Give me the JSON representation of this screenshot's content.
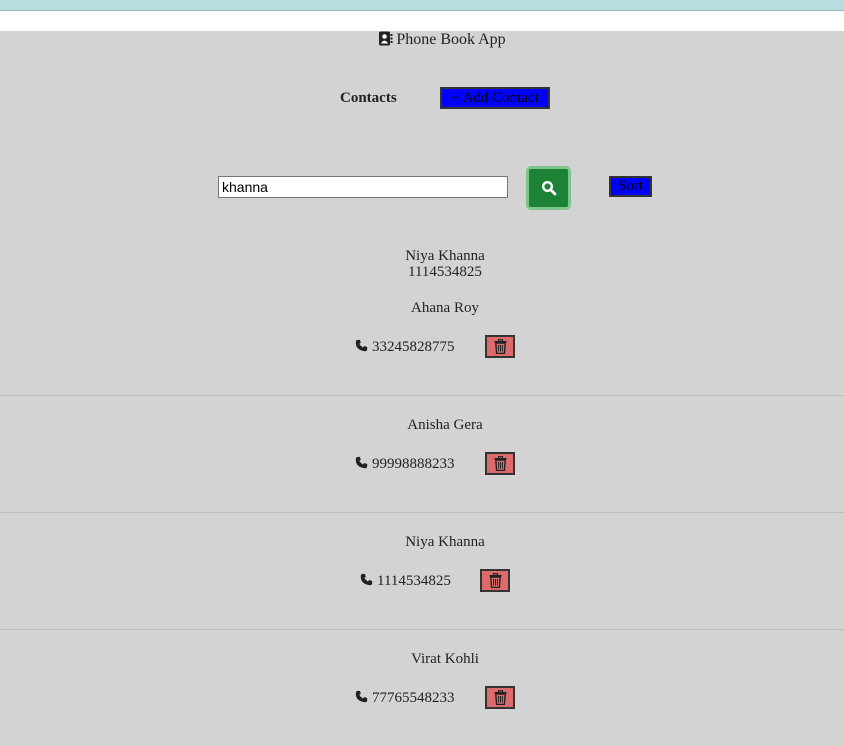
{
  "header": {
    "title": "Phone Book App"
  },
  "toolbar": {
    "contacts_label": "Contacts",
    "add_label": "+ Add Contact"
  },
  "search": {
    "value": "khanna",
    "sort_label": "Sort"
  },
  "search_result": {
    "name": "Niya Khanna",
    "phone": "1114534825"
  },
  "contacts": [
    {
      "name": "Ahana Roy",
      "phone": "33245828775"
    },
    {
      "name": "Anisha Gera",
      "phone": "99998888233"
    },
    {
      "name": "Niya Khanna",
      "phone": "1114534825"
    },
    {
      "name": "Virat Kohli",
      "phone": "77765548233"
    }
  ],
  "colors": {
    "background": "#d3d3d3",
    "primary_button": "#0000ff",
    "search_button": "#1e8236",
    "delete_button": "#de6b6b"
  },
  "icons": {
    "title": "contact-book-icon",
    "search": "search-icon",
    "phone": "phone-icon",
    "delete": "trash-icon"
  }
}
